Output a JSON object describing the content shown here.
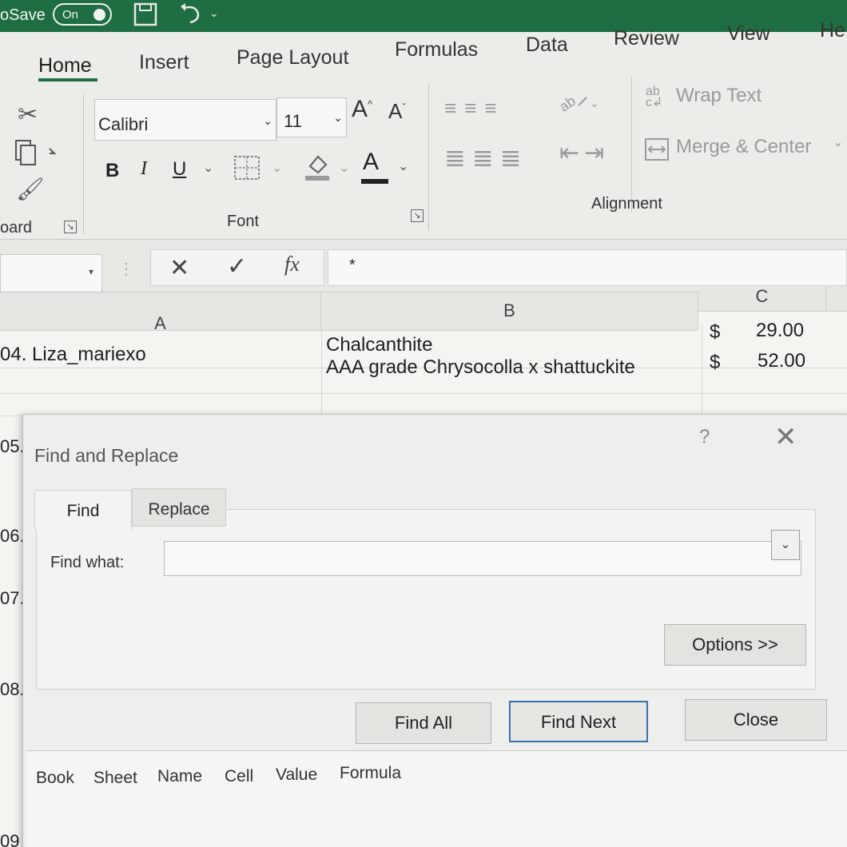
{
  "titlebar": {
    "autosave_label": "oSave",
    "toggle_label": "On"
  },
  "ribbon": {
    "tabs": [
      "Home",
      "Insert",
      "Page Layout",
      "Formulas",
      "Data",
      "Review",
      "View",
      "He"
    ],
    "active_tab": "Home",
    "font_name": "Calibri",
    "font_size": "11",
    "groups": {
      "clipboard": "oard",
      "font": "Font",
      "alignment": "Alignment"
    },
    "wrap_text": "Wrap Text",
    "merge_center": "Merge & Center",
    "bold": "B",
    "italic": "I",
    "underline": "U",
    "grow_font": "A",
    "shrink_font": "A",
    "font_color": "A"
  },
  "formula_bar": {
    "fx_label": "fx",
    "value": "*"
  },
  "grid": {
    "columns": [
      "A",
      "B",
      "C"
    ],
    "rows": [
      {
        "a": "04. Liza_mariexo",
        "b": "Chalcanthite",
        "currency": "$",
        "c": "29.00"
      },
      {
        "a": "",
        "b": "AAA grade Chrysocolla x shattuckite",
        "currency": "$",
        "c": "52.00"
      }
    ],
    "row_fragments": [
      "05.",
      "06.",
      "07.",
      "08.",
      "09"
    ]
  },
  "dialog": {
    "title": "Find and Replace",
    "help": "?",
    "tabs": {
      "find": "Find",
      "replace": "Replace"
    },
    "find_what_label": "Find what:",
    "find_what_value": "",
    "options_button": "Options >>",
    "buttons": {
      "find_all": "Find All",
      "find_next": "Find Next",
      "close": "Close"
    },
    "result_columns": [
      "Book",
      "Sheet",
      "Name",
      "Cell",
      "Value",
      "Formula"
    ]
  }
}
